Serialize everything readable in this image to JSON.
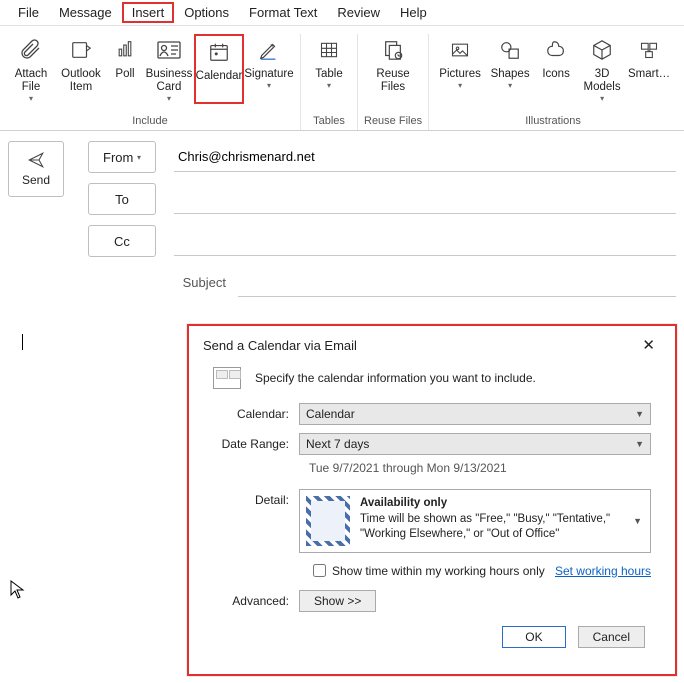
{
  "menubar": {
    "file": "File",
    "message": "Message",
    "insert": "Insert",
    "options": "Options",
    "format": "Format Text",
    "review": "Review",
    "help": "Help"
  },
  "ribbon": {
    "attach": "Attach\nFile",
    "outlook": "Outlook\nItem",
    "poll": "Poll",
    "bizcard": "Business\nCard",
    "calendar": "Calendar",
    "signature": "Signature",
    "table": "Table",
    "reuse": "Reuse\nFiles",
    "pictures": "Pictures",
    "shapes": "Shapes",
    "icons": "Icons",
    "models": "3D\nModels",
    "smartart": "Smart…",
    "g_include": "Include",
    "g_tables": "Tables",
    "g_reuse": "Reuse Files",
    "g_illus": "Illustrations"
  },
  "compose": {
    "from_label": "From",
    "to_label": "To",
    "cc_label": "Cc",
    "subject_label": "Subject",
    "send_label": "Send",
    "from_value": "Chris@chrismenard.net"
  },
  "dialog": {
    "title": "Send a Calendar via Email",
    "spec": "Specify the calendar information you want to include.",
    "lbl_calendar": "Calendar:",
    "val_calendar": "Calendar",
    "lbl_range": "Date Range:",
    "val_range": "Next 7 days",
    "range_hint": "Tue 9/7/2021 through Mon 9/13/2021",
    "lbl_detail": "Detail:",
    "detail_title": "Availability only",
    "detail_body": "Time will be shown as \"Free,\" \"Busy,\" \"Tentative,\" \"Working Elsewhere,\" or \"Out of Office\"",
    "chk_label": "Show time within my working hours only",
    "link": "Set working hours",
    "lbl_advanced": "Advanced:",
    "show": "Show >>",
    "ok": "OK",
    "cancel": "Cancel"
  }
}
